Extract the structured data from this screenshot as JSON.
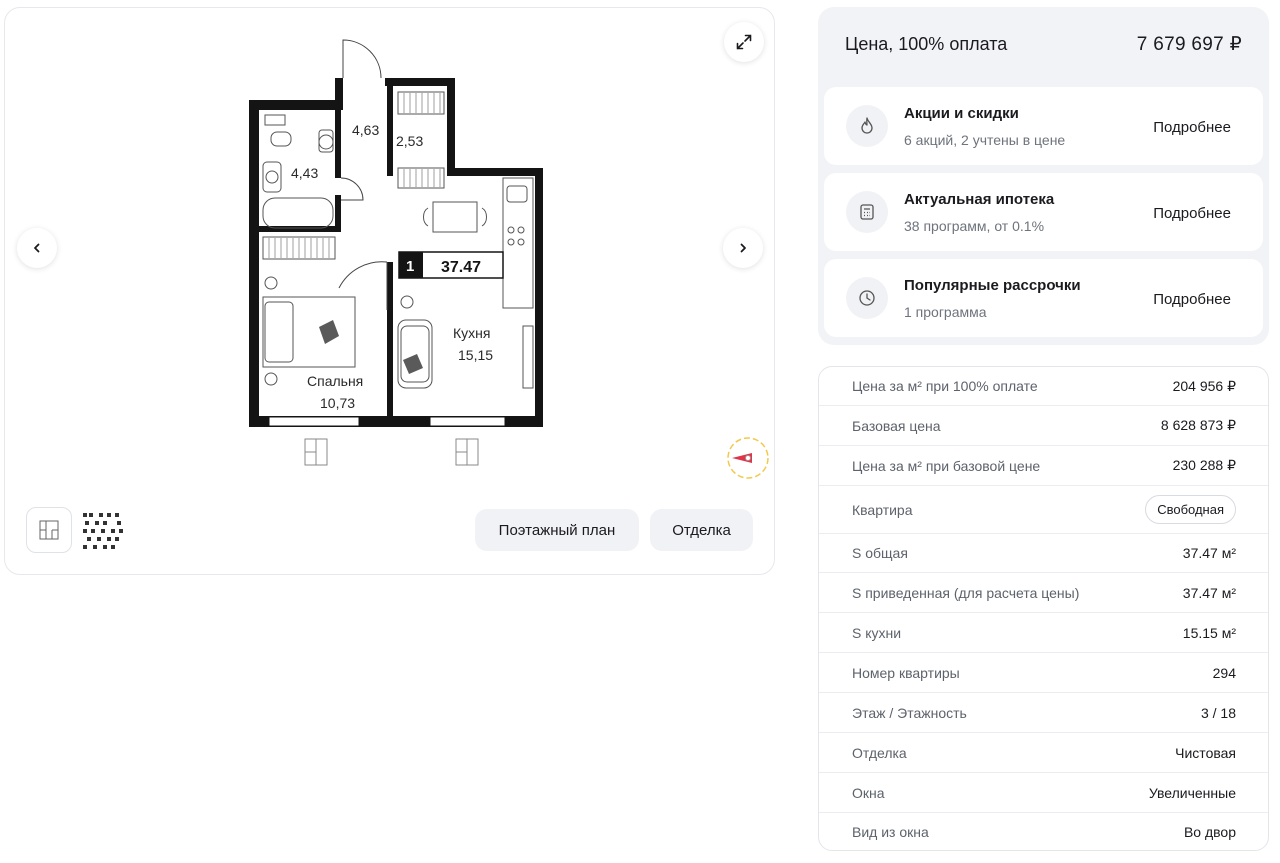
{
  "plan": {
    "rooms_count": "1",
    "total_area": "37.47",
    "room_labels": {
      "hall": "4,63",
      "bath": "4,43",
      "storage": "2,53",
      "kitchen_name": "Кухня",
      "kitchen_area": "15,15",
      "bedroom_name": "Спальня",
      "bedroom_area": "10,73"
    },
    "buttons": {
      "floor_plan": "Поэтажный план",
      "finish": "Отделка"
    }
  },
  "price": {
    "label": "Цена, 100% оплата",
    "value": "7 679 697 ₽"
  },
  "offers": [
    {
      "title": "Акции и скидки",
      "subtitle": "6 акций, 2 учтены в цене",
      "more": "Подробнее",
      "icon": "flame-icon"
    },
    {
      "title": "Актуальная ипотека",
      "subtitle": "38 программ, от 0.1%",
      "more": "Подробнее",
      "icon": "calculator-icon"
    },
    {
      "title": "Популярные рассрочки",
      "subtitle": "1 программа",
      "more": "Подробнее",
      "icon": "clock-icon"
    }
  ],
  "details": [
    {
      "key": "Цена за м² при 100% оплате",
      "value": "204 956 ₽"
    },
    {
      "key": "Базовая цена",
      "value": "8 628 873 ₽"
    },
    {
      "key": "Цена за м² при базовой цене",
      "value": "230 288 ₽"
    },
    {
      "key": "Квартира",
      "value": "Свободная"
    },
    {
      "key": "S общая",
      "value": "37.47 м²"
    },
    {
      "key": "S приведенная (для расчета цены)",
      "value": "37.47 м²"
    },
    {
      "key": "S кухни",
      "value": "15.15 м²"
    },
    {
      "key": "Номер квартиры",
      "value": "294"
    },
    {
      "key": "Этаж / Этажность",
      "value": "3 / 18"
    },
    {
      "key": "Отделка",
      "value": "Чистовая"
    },
    {
      "key": "Окна",
      "value": "Увеличенные"
    },
    {
      "key": "Вид из окна",
      "value": "Во двор"
    }
  ],
  "colors": {
    "accent_red": "#e0344a",
    "compass_ring": "#f2c94c",
    "card_bg": "#f2f3f6"
  }
}
